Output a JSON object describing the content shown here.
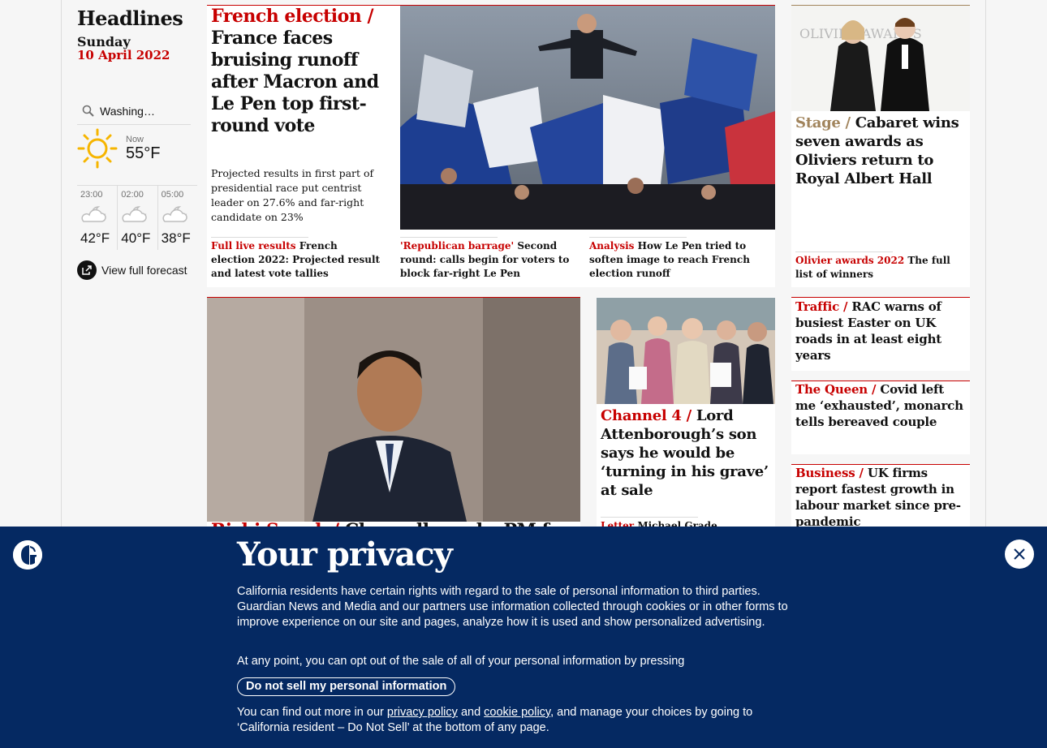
{
  "sidebar": {
    "title": "Headlines",
    "day": "Sunday",
    "date": "10 April 2022",
    "weather": {
      "location": "Washing…",
      "now_label": "Now",
      "now_temp": "55°F",
      "now_icon": "sun-icon",
      "forecast": [
        {
          "time": "23:00",
          "temp": "42°F",
          "icon": "cloudy-night-icon"
        },
        {
          "time": "02:00",
          "temp": "40°F",
          "icon": "cloudy-night-icon"
        },
        {
          "time": "05:00",
          "temp": "38°F",
          "icon": "cloudy-night-icon"
        }
      ],
      "view_full": "View full forecast"
    }
  },
  "lead": {
    "kicker": "French election /",
    "headline": "France faces bruising runoff after Macron and Le Pen top first-round vote",
    "standfirst": "Projected results in first part of presidential race put centrist leader on 27.6% and far-right candidate on 23%",
    "sublinks": [
      {
        "kicker": "Full live results",
        "text": "French election 2022: Projected result and latest vote tallies"
      },
      {
        "kicker": "'Republican barrage'",
        "text": "Second round: calls begin for voters to block far-right Le Pen"
      },
      {
        "kicker": "Analysis",
        "text": "How Le Pen tried to soften image to reach French election runoff"
      }
    ]
  },
  "stage": {
    "kicker": "Stage /",
    "headline": "Cabaret wins seven awards as Oliviers return to Royal Albert Hall",
    "sublink_kicker": "Olivier awards 2022",
    "sublink_text": "The full list of winners",
    "photo_text": "OLIVIER AWARDS"
  },
  "sunak": {
    "kicker": "Rishi Sunak /",
    "headline": "Chancellor asks PM for"
  },
  "channel4": {
    "kicker": "Channel 4 /",
    "headline": "Lord Attenborough’s son says he would be ‘turning in his grave’ at sale",
    "sublink_kicker": "Letter",
    "sublink_text": "Michael Grade promised"
  },
  "right_stories": [
    {
      "kicker": "Traffic /",
      "headline": "RAC warns of busiest Easter on UK roads in at least eight years"
    },
    {
      "kicker": "The Queen /",
      "headline": "Covid left me ‘exhausted’, monarch tells bereaved couple"
    },
    {
      "kicker": "Business /",
      "headline": "UK firms report fastest growth in labour market since pre-pandemic"
    }
  ],
  "privacy": {
    "title": "Your privacy",
    "para1": "California residents have certain rights with regard to the sale of personal information to third parties. Guardian News and Media and our partners use information collected through cookies or in other forms to improve experience on our site and pages, analyze how it is used and show personalized advertising.",
    "para2": "At any point, you can opt out of the sale of all of your personal information by pressing",
    "button": "Do not sell my personal information",
    "para3_a": "You can find out more in our",
    "link1": "privacy policy",
    "para3_b": "and",
    "link2": "cookie policy",
    "para3_c": ", and manage your choices by going to ‘California resident – Do Not Sell’ at the bottom of any page."
  },
  "colors": {
    "news": "#c70000",
    "culture": "#a1845c",
    "banner": "#052962"
  }
}
